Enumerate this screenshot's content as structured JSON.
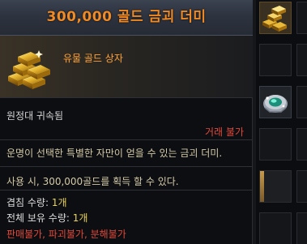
{
  "tooltip": {
    "title": "300,000 골드 금괴 더미",
    "grade": "유물 골드 상자",
    "bound": "원정대 귀속됨",
    "trade_status": "거래 불가",
    "description": "운명이 선택한 특별한 자만이 얻을 수 있는 금괴 더미.",
    "use_effect": "사용 시, 300,000골드를 획득 할 수 있다.",
    "stack_label": "겹침 수량: ",
    "stack_value": "1개",
    "total_label": "전체 보유 수량: ",
    "total_value": "1개",
    "restrictions": "판매불가, 파괴불가, 분해불가"
  },
  "icons": {
    "item": "gold-bars-icon",
    "slot_1": "gold-bars-icon",
    "slot_2": "gem-chest-icon"
  },
  "colors": {
    "title": "#f08a24",
    "grade": "#ffa23a",
    "warning": "#e0493a",
    "description": "#d3c9a8",
    "quantity": "#e8d25a"
  }
}
